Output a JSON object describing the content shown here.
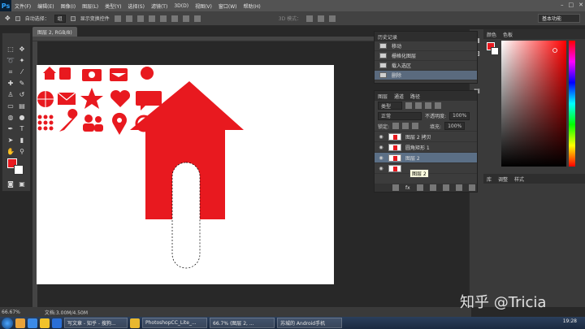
{
  "app": {
    "logo": "Ps"
  },
  "menu": [
    "文件(F)",
    "编辑(E)",
    "图像(I)",
    "图层(L)",
    "类型(Y)",
    "选择(S)",
    "滤镜(T)",
    "3D(D)",
    "视图(V)",
    "窗口(W)",
    "帮助(H)"
  ],
  "options_bar": {
    "auto_select": "自动选择：",
    "auto_select_value": "组",
    "show_transform": "显示变换控件",
    "mode_3d": "3D 模式：",
    "workspace": "基本功能"
  },
  "document_tab": {
    "title": "图层 2, RGB/8)"
  },
  "status": {
    "zoom": "66.67%",
    "doc": "文档:3.00M/4.50M"
  },
  "history": {
    "title": "历史记录",
    "items": [
      {
        "label": "移动",
        "active": false
      },
      {
        "label": "栅格化图层",
        "active": false
      },
      {
        "label": "载入选区",
        "active": false
      },
      {
        "label": "删除",
        "active": true
      }
    ]
  },
  "layers": {
    "tabs": [
      "图层",
      "通道",
      "路径"
    ],
    "filter": "类型",
    "blend_mode": "正常",
    "opacity_label": "不透明度:",
    "opacity_value": "100%",
    "lock_label": "锁定:",
    "fill_label": "填充:",
    "fill_value": "100%",
    "items": [
      {
        "name": "图层 2 拷贝",
        "active": false
      },
      {
        "name": "圆角矩形 1",
        "active": false
      },
      {
        "name": "图层 2",
        "active": true
      },
      {
        "name": "",
        "active": false
      }
    ],
    "tooltip": "图层 2"
  },
  "color_panel": {
    "tabs": [
      "颜色",
      "色板"
    ]
  },
  "swatch_panel": {
    "tabs": [
      "库",
      "调整",
      "样式"
    ]
  },
  "taskbar": {
    "tasks": [
      "写文章 - 知乎 - 搜狗...",
      "PhotoshopCC_Lite_...",
      "66.7% (图层 2, ...",
      "苏城的 Android手机"
    ],
    "time": "19:28"
  },
  "watermark": "知乎 @Tricia",
  "colors": {
    "accent_red": "#e8191f"
  }
}
